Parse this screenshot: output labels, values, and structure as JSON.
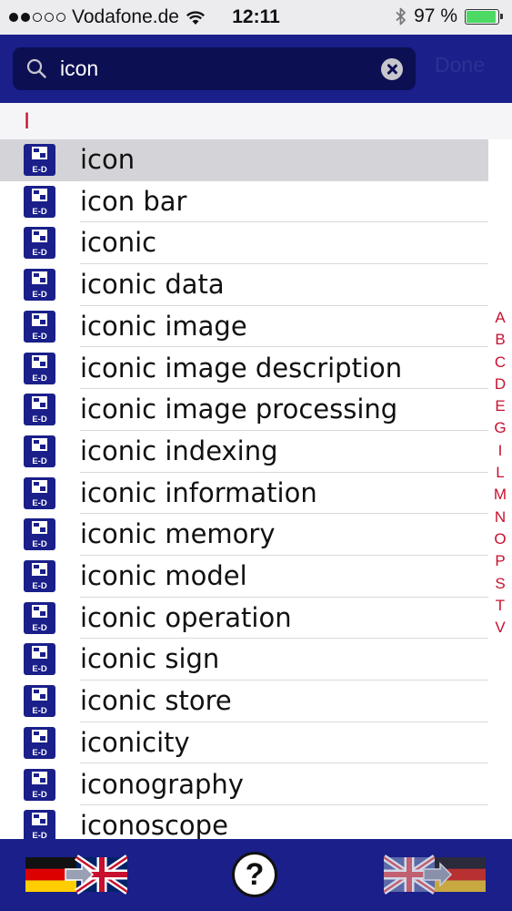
{
  "status_bar": {
    "carrier": "Vodafone.de",
    "time": "12:11",
    "battery_percent": "97 %",
    "battery_level": 0.97,
    "signal_bars_filled": 2
  },
  "search": {
    "value": "icon",
    "done_label": "Done"
  },
  "section": {
    "letter": "I"
  },
  "results": [
    {
      "word": "icon"
    },
    {
      "word": "icon bar"
    },
    {
      "word": "iconic"
    },
    {
      "word": "iconic data"
    },
    {
      "word": "iconic image"
    },
    {
      "word": "iconic image description"
    },
    {
      "word": "iconic image processing"
    },
    {
      "word": "iconic indexing"
    },
    {
      "word": "iconic information"
    },
    {
      "word": "iconic memory"
    },
    {
      "word": "iconic model"
    },
    {
      "word": "iconic operation"
    },
    {
      "word": "iconic sign"
    },
    {
      "word": "iconic store"
    },
    {
      "word": "iconicity"
    },
    {
      "word": "iconography"
    },
    {
      "word": "iconoscope"
    }
  ],
  "selected_index": 0,
  "entry_icon_label": "E-D",
  "alphabet_index": [
    "A",
    "B",
    "C",
    "D",
    "E",
    "G",
    "I",
    "L",
    "M",
    "N",
    "O",
    "P",
    "S",
    "T",
    "V"
  ],
  "toolbar": {
    "help_label": "?"
  },
  "colors": {
    "header": "#1a1f8a",
    "search_field": "#0c0f52",
    "index_red": "#c8102e",
    "selected_row": "#d3d3d8"
  }
}
